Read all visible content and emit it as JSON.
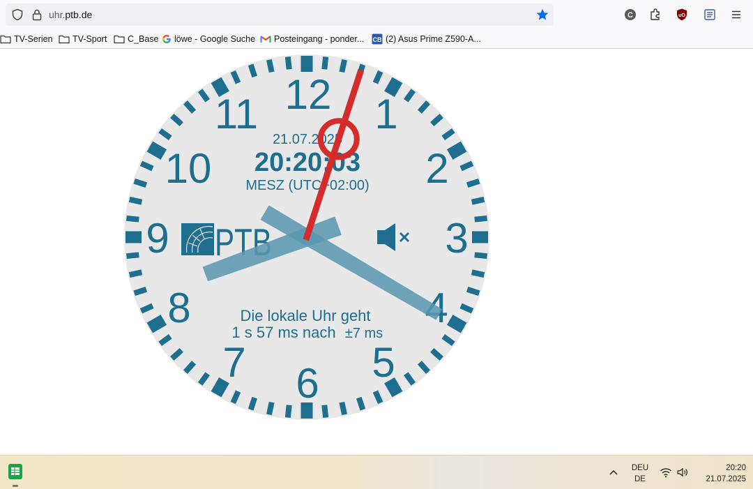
{
  "browser": {
    "url_prefix": "uhr.",
    "url_domain": "ptb.de",
    "bookmarks": [
      {
        "label": "TV-Serien",
        "icon": "folder-icon"
      },
      {
        "label": "TV-Sport",
        "icon": "folder-icon"
      },
      {
        "label": "C_Base",
        "icon": "folder-icon"
      },
      {
        "label": "löwe - Google Suche",
        "icon": "google-icon"
      },
      {
        "label": "Posteingang - ponder...",
        "icon": "gmail-icon"
      },
      {
        "label": "(2) Asus Prime Z590-A...",
        "icon": "cb-icon"
      }
    ],
    "toolbar_icons": [
      "shield-icon",
      "lock-icon",
      "bookmark-star-icon",
      "c-extension-icon",
      "extensions-puzzle-icon",
      "ublock-icon",
      "reader-view-icon",
      "menu-icon"
    ]
  },
  "clock": {
    "date": "21.07.2025",
    "time": "20:20:03",
    "timezone": "MESZ (UTC+02:00)",
    "numerals": [
      "12",
      "1",
      "2",
      "3",
      "4",
      "5",
      "6",
      "7",
      "8",
      "9",
      "10",
      "11"
    ],
    "logo_text": "PTB",
    "status_line1": "Die lokale Uhr geht",
    "status_line2": "1 s 57 ms nach",
    "status_tolerance": "±7 ms",
    "hands": {
      "hour": 20.3342,
      "minute": 20.05,
      "second": 3
    },
    "sound": "muted",
    "colors": {
      "accent": "#1d6e8f",
      "face": "#e8e8e8",
      "second_hand": "#d42b2b",
      "hands": "#5b97b0"
    }
  },
  "taskbar": {
    "lang_top": "DEU",
    "lang_bottom": "DE",
    "time": "20:20",
    "date": "21.07.2025"
  }
}
